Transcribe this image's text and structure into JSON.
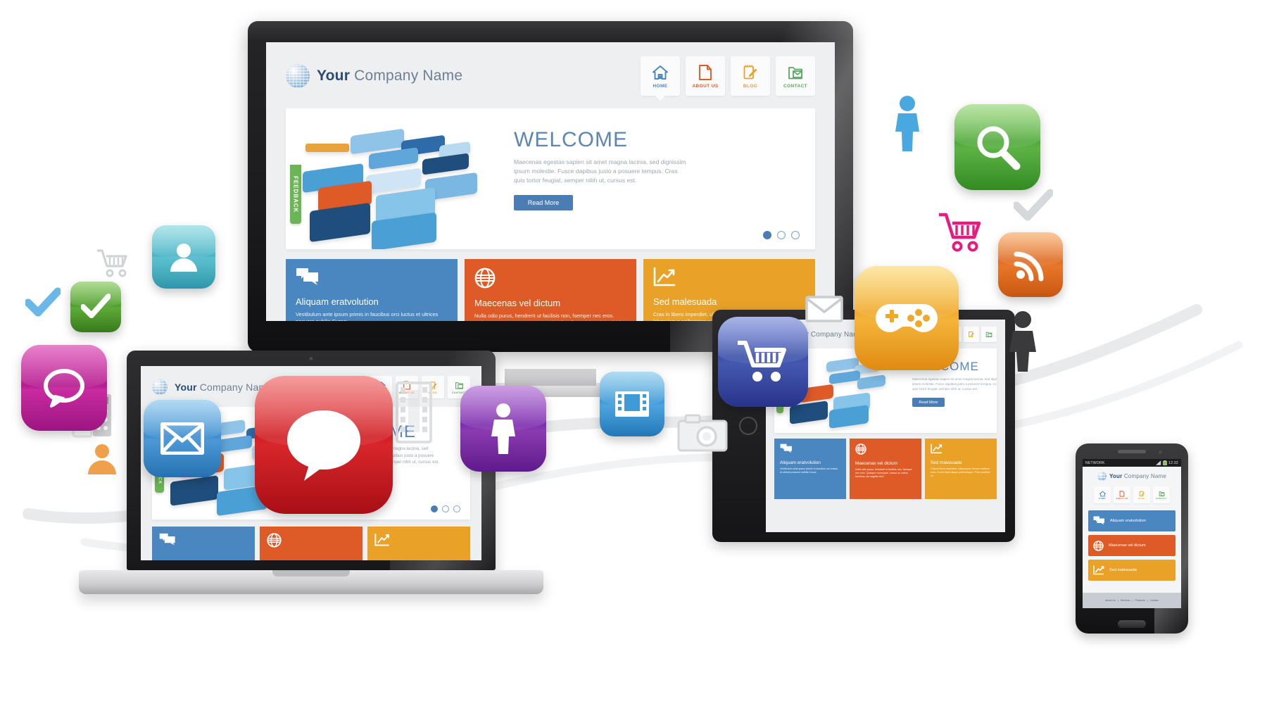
{
  "site": {
    "brand_bold": "Your",
    "brand_rest": " Company Name",
    "logo_icon": "globe-icon",
    "nav": [
      {
        "label": "HOME",
        "icon": "home-icon",
        "color": "#4a86c0",
        "active": true
      },
      {
        "label": "ABOUT US",
        "icon": "document-icon",
        "color": "#de5b27",
        "active": false
      },
      {
        "label": "BLOG",
        "icon": "notepad-pencil-icon",
        "color": "#e9a227",
        "active": false
      },
      {
        "label": "CONTACT",
        "icon": "mail-folder-icon",
        "color": "#5aa860",
        "active": false
      }
    ],
    "hero": {
      "heading": "WELCOME",
      "paragraph": "Maecenas egestas sapien sit amet magna lacinia, sed dignissim ipsum molestie. Fusce dapibus justo a posuere tempus. Cras quis tortor feugiat, semper nibh ut, cursus est.",
      "button_label": "Read More",
      "slider_dots": 3,
      "slider_active_index": 0
    },
    "feedback_tab": {
      "label": "FEEDBACK",
      "icon": "speech-bubble-icon",
      "color": "#6cb557"
    },
    "cards": [
      {
        "title": "Aliquam eratvolution",
        "body": "Vestibulum ante ipsum primis in faucibus orci luctus et ultrices posuere cubilia Curae;",
        "icon": "chat-bubbles-icon",
        "color": "#4a86c0"
      },
      {
        "title": "Maecenas vel dictum",
        "body": "Nulla odio purus, hendrerit ut facilisis non, fsemper nec eros. Quisque consequat, massa ac varius faucibus, dui sagittis nisl.f",
        "icon": "globe-grid-icon",
        "color": "#de5b27"
      },
      {
        "title": "Sed malesuada",
        "body": "Cras in libero imperdiet, ullamcorper tempor eleifend urna. Donec laboruisque pellentesque. Proin pulvinar mi.",
        "icon": "growth-chart-icon",
        "color": "#e9a227"
      }
    ]
  },
  "phone": {
    "carrier": "NETWORK",
    "time": "12:32",
    "signal_icon": "signal-bars-icon",
    "battery_icon": "battery-icon",
    "footer_links": [
      "About Us",
      "Services",
      "Products",
      "Contact"
    ],
    "footer_separator": "|"
  },
  "devices": [
    {
      "name": "desktop-monitor"
    },
    {
      "name": "laptop"
    },
    {
      "name": "tablet"
    },
    {
      "name": "smartphone"
    }
  ],
  "floating_icons": [
    {
      "name": "chat-bubble-app-icon",
      "icon": "chat-bubble-icon",
      "color": "#c0209c"
    },
    {
      "name": "user-app-icon",
      "icon": "user-icon",
      "color": "#4cb4c7"
    },
    {
      "name": "checkmark-app-icon",
      "icon": "check-icon",
      "color": "#5aa832"
    },
    {
      "name": "envelope-app-icon",
      "icon": "envelope-icon",
      "color": "#3f8ed0"
    },
    {
      "name": "speech-bubble-app-icon",
      "icon": "speech-bubble-icon",
      "color": "#d8262b"
    },
    {
      "name": "person-app-icon",
      "icon": "person-icon",
      "color": "#8b3bb0"
    },
    {
      "name": "film-app-icon",
      "icon": "film-strip-icon",
      "color": "#3f9ad8"
    },
    {
      "name": "cart-app-icon",
      "icon": "shopping-cart-icon",
      "color": "#3b4fa8"
    },
    {
      "name": "gamepad-app-icon",
      "icon": "gamepad-icon",
      "color": "#f0b429"
    },
    {
      "name": "search-app-icon",
      "icon": "magnifier-icon",
      "color": "#56b84a"
    },
    {
      "name": "rss-app-icon",
      "icon": "rss-icon",
      "color": "#e8722a"
    }
  ],
  "flat_icons": [
    {
      "name": "cart-flat-icon-left",
      "icon": "shopping-cart-icon",
      "color": "#d0d3d6"
    },
    {
      "name": "check-flat-icon-blue",
      "icon": "check-icon",
      "color": "#6ab8e8"
    },
    {
      "name": "check-flat-icon-white",
      "icon": "check-icon",
      "color": "#ffffff"
    },
    {
      "name": "check-flat-icon-gray",
      "icon": "check-icon",
      "color": "#d6d9dc"
    },
    {
      "name": "user-flat-icon-orange",
      "icon": "user-icon",
      "color": "#f0a04b"
    },
    {
      "name": "user-flat-icon-blue",
      "icon": "person-icon",
      "color": "#4aa8e0"
    },
    {
      "name": "cart-flat-icon-pink",
      "icon": "shopping-cart-icon",
      "color": "#e8197f"
    },
    {
      "name": "envelope-flat-icon",
      "icon": "envelope-icon",
      "color": "#d8dbde"
    },
    {
      "name": "camera-flat-icon",
      "icon": "camera-icon",
      "color": "#e6e8ea"
    },
    {
      "name": "film-flat-icon",
      "icon": "film-strip-icon",
      "color": "#dcdfe2"
    },
    {
      "name": "calculator-flat-icon",
      "icon": "calculator-icon",
      "color": "#dcdfe2"
    },
    {
      "name": "person-dark-icon",
      "icon": "person-icon",
      "color": "#3a3a3c"
    }
  ]
}
